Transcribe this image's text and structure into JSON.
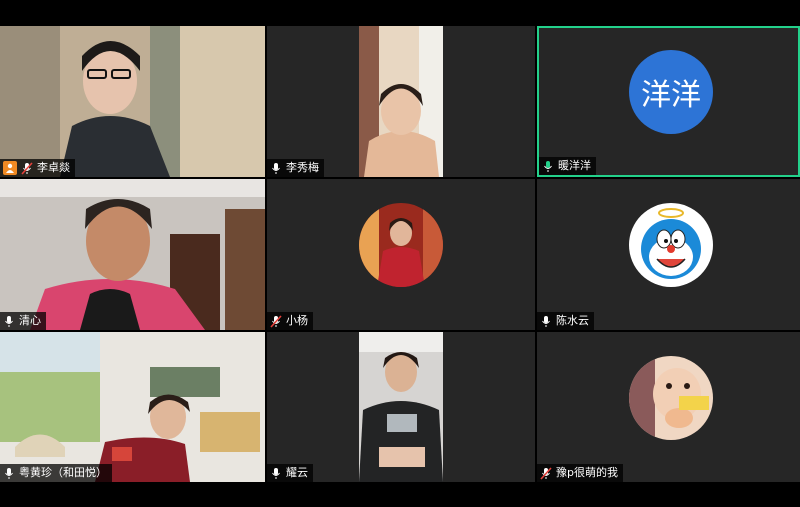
{
  "participants": [
    {
      "name": "李卓燚",
      "host": true,
      "mic": "muted"
    },
    {
      "name": "李秀梅",
      "host": false,
      "mic": "on"
    },
    {
      "name": "暖洋洋",
      "host": false,
      "mic": "active",
      "avatar_text": "洋洋",
      "avatar_color": "#2d74d6"
    },
    {
      "name": "清心",
      "host": false,
      "mic": "on"
    },
    {
      "name": "小杨",
      "host": false,
      "mic": "muted"
    },
    {
      "name": "陈水云",
      "host": false,
      "mic": "on"
    },
    {
      "name": "粤黄珍（和田悦）",
      "host": false,
      "mic": "on"
    },
    {
      "name": "耀云",
      "host": false,
      "mic": "on"
    },
    {
      "name": "豫p很萌的我",
      "host": false,
      "mic": "muted"
    }
  ],
  "colors": {
    "tile_bg": "#262626",
    "active_speaker_border": "#23d18b",
    "muted_red": "#e5413b",
    "host_badge": "#f08a24"
  },
  "icons": [
    "microphone-icon",
    "microphone-muted-icon",
    "host-icon"
  ]
}
